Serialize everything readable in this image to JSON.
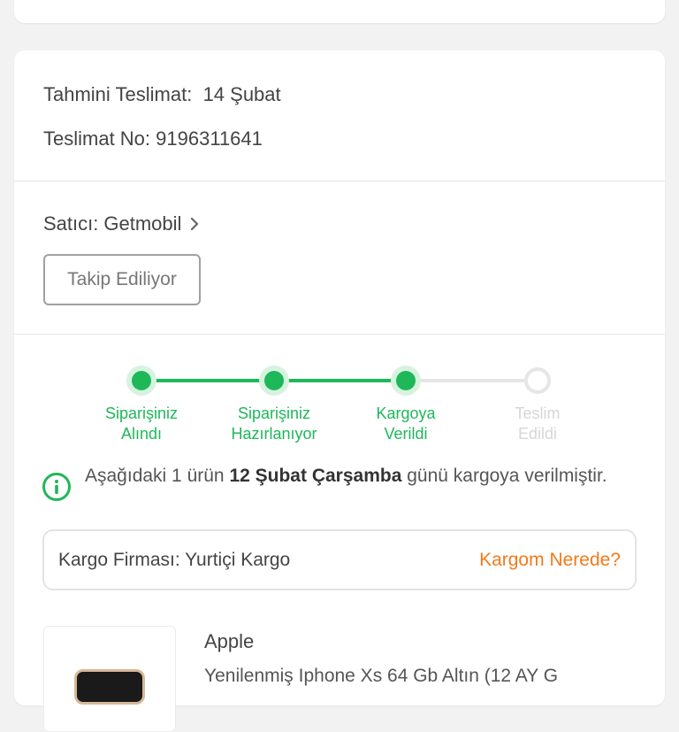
{
  "delivery": {
    "estimate_label": "Tahmini Teslimat:",
    "estimate_value": "14 Şubat",
    "number_label": "Teslimat No:",
    "number_value": "9196311641"
  },
  "seller": {
    "label": "Satıcı:",
    "name": "Getmobil",
    "follow_button": "Takip Ediliyor"
  },
  "steps": [
    {
      "line1": "Siparişiniz",
      "line2": "Alındı",
      "status": "done"
    },
    {
      "line1": "Siparişiniz",
      "line2": "Hazırlanıyor",
      "status": "done"
    },
    {
      "line1": "Kargoya",
      "line2": "Verildi",
      "status": "done"
    },
    {
      "line1": "Teslim",
      "line2": "Edildi",
      "status": "pending"
    }
  ],
  "info": {
    "prefix": "Aşağıdaki 1 ürün",
    "highlight": "12 Şubat Çarşamba",
    "suffix": "günü kargoya verilmiştir."
  },
  "cargo": {
    "label": "Kargo Firması:",
    "company": "Yurtiçi Kargo",
    "track_link": "Kargom Nerede?"
  },
  "product": {
    "brand": "Apple",
    "name": "Yenilenmiş Iphone Xs 64 Gb Altın (12 AY G"
  },
  "colors": {
    "accent_green": "#1eb85a",
    "link_orange": "#f27a1a",
    "pending_gray": "#d6d6d6"
  }
}
